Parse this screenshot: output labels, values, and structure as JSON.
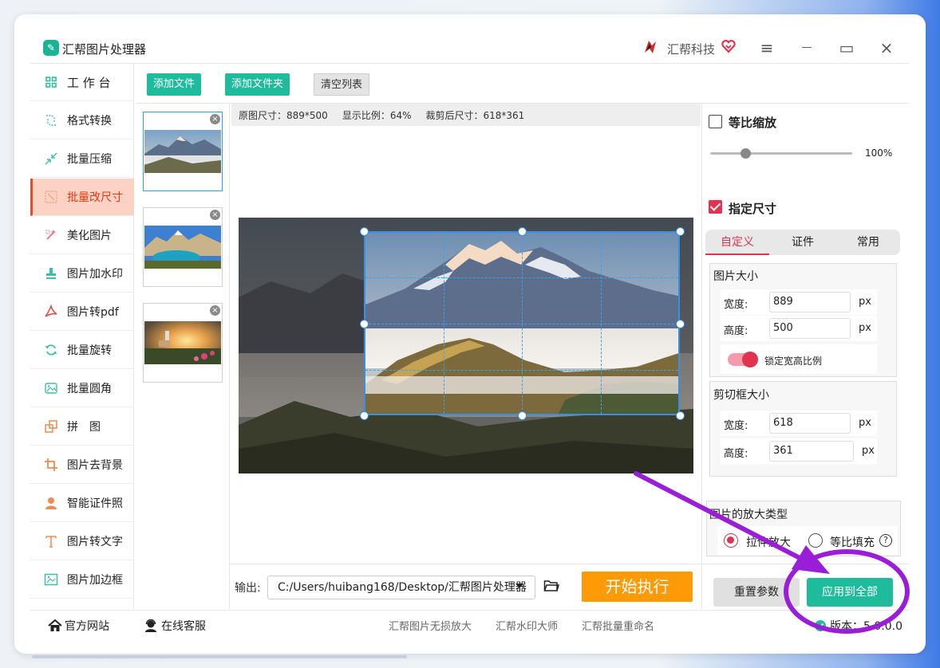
{
  "app": {
    "title": "汇帮图片处理器",
    "brand": "汇帮科技"
  },
  "window_controls": {
    "menu": "≡",
    "minimize": "—",
    "maximize": "▭",
    "close": "×"
  },
  "sidebar": {
    "items": [
      {
        "label": "工 作 台",
        "icon": "grid-icon"
      },
      {
        "label": "格式转换",
        "icon": "convert-icon"
      },
      {
        "label": "批量压缩",
        "icon": "compress-icon"
      },
      {
        "label": "批量改尺寸",
        "icon": "resize-icon",
        "active": true
      },
      {
        "label": "美化图片",
        "icon": "beautify-icon"
      },
      {
        "label": "图片加水印",
        "icon": "watermark-icon"
      },
      {
        "label": "图片转pdf",
        "icon": "pdf-icon"
      },
      {
        "label": "批量旋转",
        "icon": "rotate-icon"
      },
      {
        "label": "批量圆角",
        "icon": "round-corner-icon"
      },
      {
        "label": "拼　图",
        "icon": "puzzle-icon"
      },
      {
        "label": "图片去背景",
        "icon": "crop-icon"
      },
      {
        "label": "智能证件照",
        "icon": "person-icon"
      },
      {
        "label": "图片转文字",
        "icon": "text-icon"
      },
      {
        "label": "图片加边框",
        "icon": "frame-icon"
      }
    ]
  },
  "toolbar": {
    "add_file": "添加文件",
    "add_folder": "添加文件夹",
    "clear_list": "清空列表"
  },
  "thumbnails": [
    {
      "name": "mountain-sea-of-clouds",
      "selected": true
    },
    {
      "name": "alpine-lake"
    },
    {
      "name": "lighthouse-sunset"
    }
  ],
  "info": {
    "original_size": "原图尺寸：889*500",
    "display_ratio": "显示比例：64%",
    "cropped_size": "裁剪后尺寸：618*361"
  },
  "output": {
    "label": "输出:",
    "path": "C:/Users/huibang168/Desktop/汇帮图片处理器",
    "start": "开始执行"
  },
  "right": {
    "proportional_label": "等比缩放",
    "proportional_checked": false,
    "scale_value": "100%",
    "scale_fraction": 0.25,
    "specified_label": "指定尺寸",
    "specified_checked": true,
    "tabs": [
      "自定义",
      "证件",
      "常用"
    ],
    "active_tab": 0,
    "image_size": {
      "title": "图片大小",
      "width_label": "宽度:",
      "width": "889",
      "height_label": "高度:",
      "height": "500",
      "unit": "px",
      "lock_label": "锁定宽高比例",
      "lock_on": true
    },
    "crop_size": {
      "title": "剪切框大小",
      "width_label": "宽度:",
      "width": "618",
      "height_label": "高度:",
      "height": "361",
      "unit": "px"
    },
    "enlarge": {
      "title": "图片的放大类型",
      "options": [
        "拉伸放大",
        "等比填充"
      ],
      "selected": 0,
      "help": "?"
    },
    "reset": "重置参数",
    "apply_all": "应用到全部"
  },
  "footer": {
    "website": "官方网站",
    "support": "在线客服",
    "products": [
      "汇帮图片无损放大",
      "汇帮水印大师",
      "汇帮批量重命名"
    ],
    "version": "版本：5.0.0.0"
  },
  "colors": {
    "accent_green": "#1ebc9c",
    "accent_red": "#e0334f",
    "start_orange": "#fe9a05",
    "sidebar_active_bg": "#fbd2c4",
    "annotation_purple": "#9a1ed8"
  }
}
